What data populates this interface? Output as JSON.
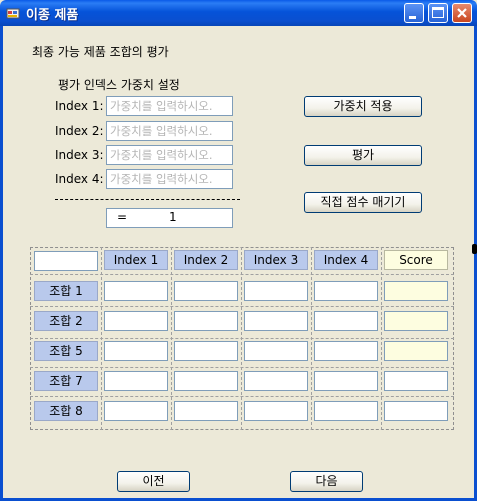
{
  "window": {
    "title": "이종 제품"
  },
  "main": {
    "heading": "최종 가능 제품 조합의 평가",
    "weight_title": "평가 인덱스 가중치 설정",
    "index_labels": [
      "Index 1:",
      "Index 2:",
      "Index 3:",
      "Index 4:"
    ],
    "input_placeholder": "가중치를 입력하시오.",
    "sum_equals": "=",
    "sum_value": "1"
  },
  "buttons": {
    "apply_weights": "가중치 적용",
    "evaluate": "평가",
    "direct_score": "직접 점수 매기기",
    "prev": "이전",
    "next": "다음"
  },
  "table": {
    "headers": [
      "Index 1",
      "Index 2",
      "Index 3",
      "Index 4",
      "Score"
    ],
    "rows": [
      "조합 1",
      "조합 2",
      "조합 5",
      "조합 7",
      "조합 8"
    ]
  }
}
